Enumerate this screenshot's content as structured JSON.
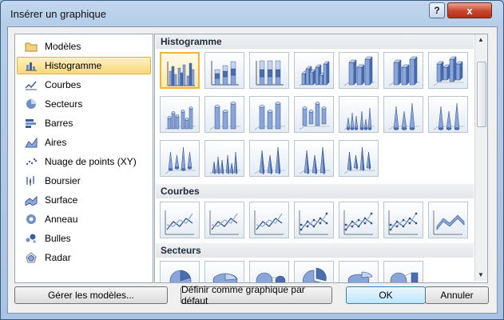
{
  "window": {
    "title": "Insérer un graphique",
    "help_glyph": "?",
    "close_glyph": "x"
  },
  "categories": [
    {
      "label": "Modèles",
      "icon": "folder-icon"
    },
    {
      "label": "Histogramme",
      "icon": "column-chart-icon",
      "selected": true
    },
    {
      "label": "Courbes",
      "icon": "line-chart-icon"
    },
    {
      "label": "Secteurs",
      "icon": "pie-chart-icon"
    },
    {
      "label": "Barres",
      "icon": "bar-chart-icon"
    },
    {
      "label": "Aires",
      "icon": "area-chart-icon"
    },
    {
      "label": "Nuage de points (XY)",
      "icon": "scatter-chart-icon"
    },
    {
      "label": "Boursier",
      "icon": "stock-chart-icon"
    },
    {
      "label": "Surface",
      "icon": "surface-chart-icon"
    },
    {
      "label": "Anneau",
      "icon": "doughnut-chart-icon"
    },
    {
      "label": "Bulles",
      "icon": "bubble-chart-icon"
    },
    {
      "label": "Radar",
      "icon": "radar-chart-icon"
    }
  ],
  "sections": [
    {
      "title": "Histogramme",
      "thumbnails": [
        "clustered-column",
        "stacked-column",
        "100-stacked-column",
        "3d-clustered-column",
        "3d-stacked-column",
        "3d-100-stacked-column",
        "3d-column",
        "clustered-cylinder",
        "stacked-cylinder",
        "100-stacked-cylinder",
        "3d-cylinder",
        "clustered-cone",
        "stacked-cone",
        "100-stacked-cone",
        "3d-cone",
        "clustered-pyramid",
        "stacked-pyramid",
        "100-stacked-pyramid",
        "3d-pyramid"
      ]
    },
    {
      "title": "Courbes",
      "thumbnails": [
        "line",
        "stacked-line",
        "100-stacked-line",
        "line-markers",
        "stacked-line-markers",
        "100-stacked-line-markers",
        "3d-line"
      ]
    },
    {
      "title": "Secteurs",
      "thumbnails": [
        "pie",
        "3d-pie",
        "pie-of-pie",
        "exploded-pie",
        "3d-exploded-pie",
        "bar-of-pie"
      ]
    }
  ],
  "buttons": {
    "manage": "Gérer les modèles...",
    "set_default": "Définir comme graphique par défaut",
    "ok": "OK",
    "cancel": "Annuler"
  },
  "colors": {
    "accent": "#f0b33c",
    "chart_blue": "#6f8fc7",
    "chart_dark": "#3d5e9e"
  }
}
